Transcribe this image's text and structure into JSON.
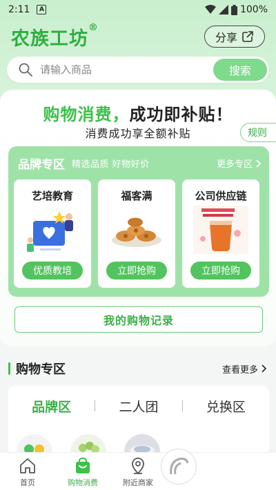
{
  "status": {
    "time": "2:11",
    "battery": "100%"
  },
  "header": {
    "logo": "农族工坊",
    "logo_mark": "®",
    "share_label": "分享"
  },
  "search": {
    "placeholder": "请输入商品",
    "button_label": "搜索"
  },
  "promo": {
    "title_green": "购物消费，",
    "title_dark": "成功即补贴！",
    "subtitle": "消费成功享全额补贴",
    "rules_label": "规则"
  },
  "brand": {
    "title": "品牌专区",
    "slogan": "精选品质 好物好价",
    "more_label": "更多专区",
    "cards": [
      {
        "title": "艺培教育",
        "button": "优质教培",
        "icon": "education-illustration"
      },
      {
        "title": "福客满",
        "button": "立即抢购",
        "icon": "pastry-plate-image"
      },
      {
        "title": "公司供应链",
        "button": "立即抢购",
        "icon": "juice-drink-image"
      }
    ]
  },
  "records_label": "我的购物记录",
  "shopping": {
    "title": "购物专区",
    "more_label": "查看更多",
    "tabs": [
      {
        "label": "品牌区",
        "active": true
      },
      {
        "label": "二人团",
        "active": false
      },
      {
        "label": "兑换区",
        "active": false
      }
    ]
  },
  "nav": {
    "items": [
      {
        "label": "首页",
        "icon": "home-icon",
        "active": false
      },
      {
        "label": "购物消费",
        "icon": "shopping-bag-icon",
        "active": true
      },
      {
        "label": "附近商家",
        "icon": "location-pin-icon",
        "active": false
      }
    ]
  },
  "colors": {
    "accent": "#3cc14a",
    "panel": "#9fe2a8",
    "button": "#53c35f"
  }
}
